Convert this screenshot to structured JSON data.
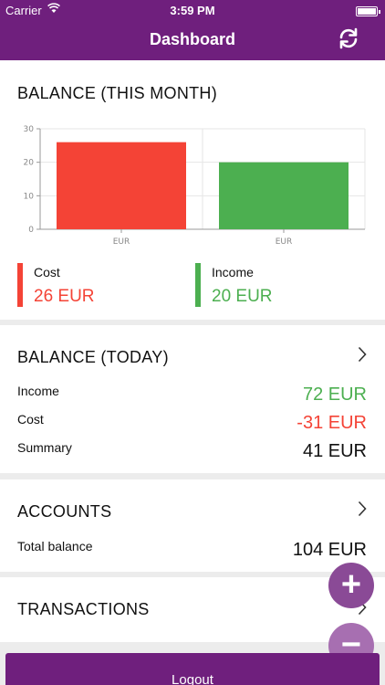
{
  "status_bar": {
    "carrier": "Carrier",
    "time": "3:59 PM"
  },
  "header": {
    "title": "Dashboard",
    "refresh_icon": "refresh-icon"
  },
  "balance_month": {
    "title": "BALANCE (THIS MONTH)",
    "legend": [
      {
        "label": "Cost",
        "value": "26 EUR",
        "color": "#f44336"
      },
      {
        "label": "Income",
        "value": "20 EUR",
        "color": "#4caf50"
      }
    ]
  },
  "chart_data": {
    "type": "bar",
    "categories": [
      "EUR",
      "EUR"
    ],
    "values": [
      26,
      20
    ],
    "colors": [
      "#f44336",
      "#4caf50"
    ],
    "yticks": [
      0,
      10,
      20,
      30
    ],
    "ylim": [
      0,
      30
    ],
    "grid": true
  },
  "balance_today": {
    "title": "BALANCE (TODAY)",
    "rows": [
      {
        "label": "Income",
        "value": "72 EUR",
        "color": "#4caf50"
      },
      {
        "label": "Cost",
        "value": "-31 EUR",
        "color": "#f44336"
      },
      {
        "label": "Summary",
        "value": "41 EUR",
        "color": "#111111"
      }
    ]
  },
  "accounts": {
    "title": "ACCOUNTS",
    "total_label": "Total balance",
    "total_value": "104 EUR"
  },
  "transactions": {
    "title": "TRANSACTIONS"
  },
  "fab": {
    "add": "+",
    "remove": "−"
  },
  "logout": {
    "label": "Logout"
  }
}
